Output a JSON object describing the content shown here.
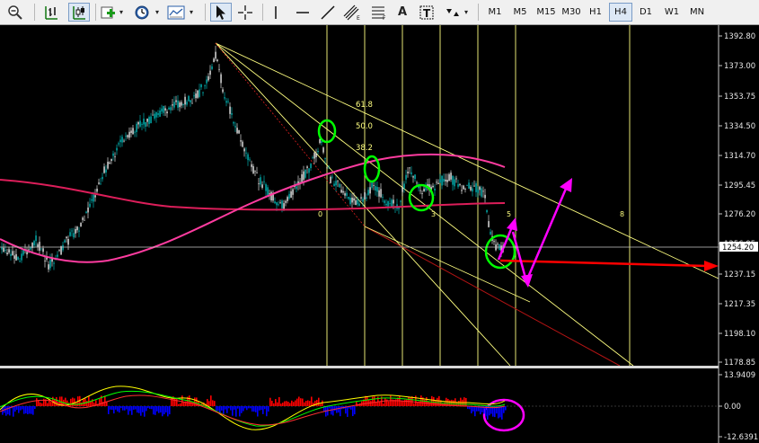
{
  "toolbar": {
    "icons": [
      "zoom-out-icon",
      "bar-chart-icon",
      "candlestick-icon",
      "new-chart-icon",
      "periodicity-clock-icon",
      "templates-icon",
      "cursor-icon",
      "crosshair-icon",
      "vertical-line-icon",
      "horizontal-line-icon",
      "trendline-icon",
      "equidistant-channel-icon",
      "fibonacci-icon",
      "text-icon",
      "text-label-icon",
      "arrows-icon"
    ],
    "text_tool_label": "A",
    "timeframes": [
      {
        "label": "M1"
      },
      {
        "label": "M5"
      },
      {
        "label": "M15"
      },
      {
        "label": "M30"
      },
      {
        "label": "H1"
      },
      {
        "label": "H4",
        "active": true
      },
      {
        "label": "D1"
      },
      {
        "label": "W1"
      },
      {
        "label": "MN"
      }
    ]
  },
  "price_axis": {
    "labels": [
      "1392.80",
      "1373.00",
      "1353.75",
      "1334.50",
      "1314.70",
      "1295.45",
      "1276.20",
      "1256.95",
      "1237.15",
      "1217.35",
      "1198.10",
      "1178.85"
    ],
    "current_price": "1254.20"
  },
  "fib_levels": [
    "61.8",
    "50.0",
    "38.2"
  ],
  "cycle_labels": [
    "0",
    "3",
    "5",
    "8"
  ],
  "indicator_axis": {
    "labels": [
      "13.9409",
      "0.00",
      "-12.6391"
    ]
  },
  "colors": {
    "background": "#000000",
    "candle_up": "#ffffff",
    "candle_down": "#00c8c8",
    "ma_long": "#dc1e5a",
    "ma_medium": "#ff3ca0",
    "trend_lines": "#ffff80",
    "circles": "#00ff00",
    "arrows": "#ff00ff",
    "horizontal_arrow": "#ff0000",
    "hist_up": "#ff0000",
    "hist_down": "#0000ff"
  }
}
